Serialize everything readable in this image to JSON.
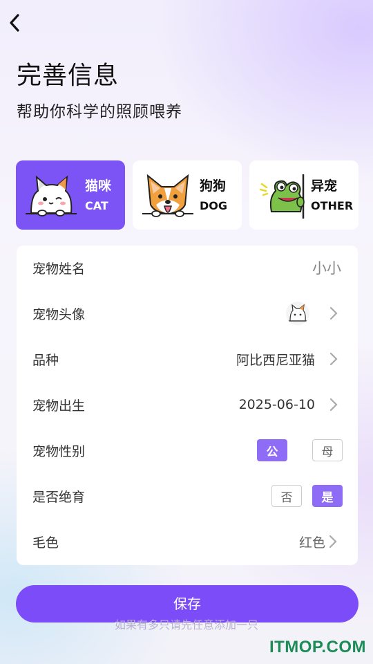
{
  "header": {
    "back_icon": "chevron-left-icon",
    "title": "完善信息",
    "subtitle": "帮助你科学的照顾喂养"
  },
  "pet_types": [
    {
      "cn": "猫咪",
      "en": "CAT",
      "icon": "cat-icon",
      "selected": true
    },
    {
      "cn": "狗狗",
      "en": "DOG",
      "icon": "dog-icon",
      "selected": false
    },
    {
      "cn": "异宠",
      "en": "OTHER",
      "icon": "frog-icon",
      "selected": false
    }
  ],
  "form": {
    "name": {
      "label": "宠物姓名",
      "value": "小小"
    },
    "avatar": {
      "label": "宠物头像",
      "icon": "cat-avatar-icon"
    },
    "breed": {
      "label": "品种",
      "value": "阿比西尼亚猫"
    },
    "birth": {
      "label": "宠物出生",
      "value": "2025-06-10"
    },
    "gender": {
      "label": "宠物性别",
      "options": [
        "公",
        "母"
      ],
      "selected": "公"
    },
    "neutered": {
      "label": "是否绝育",
      "options": [
        "否",
        "是"
      ],
      "selected": "是"
    },
    "fur": {
      "label": "毛色",
      "value": "红色"
    }
  },
  "save_label": "保存",
  "hint": "如果有多只请先任意添加一只",
  "watermark": "ITMOP.COM",
  "colors": {
    "accent": "#7c54f6",
    "chip_on": "#8f6cf5",
    "watermark": "#1b8c57"
  }
}
